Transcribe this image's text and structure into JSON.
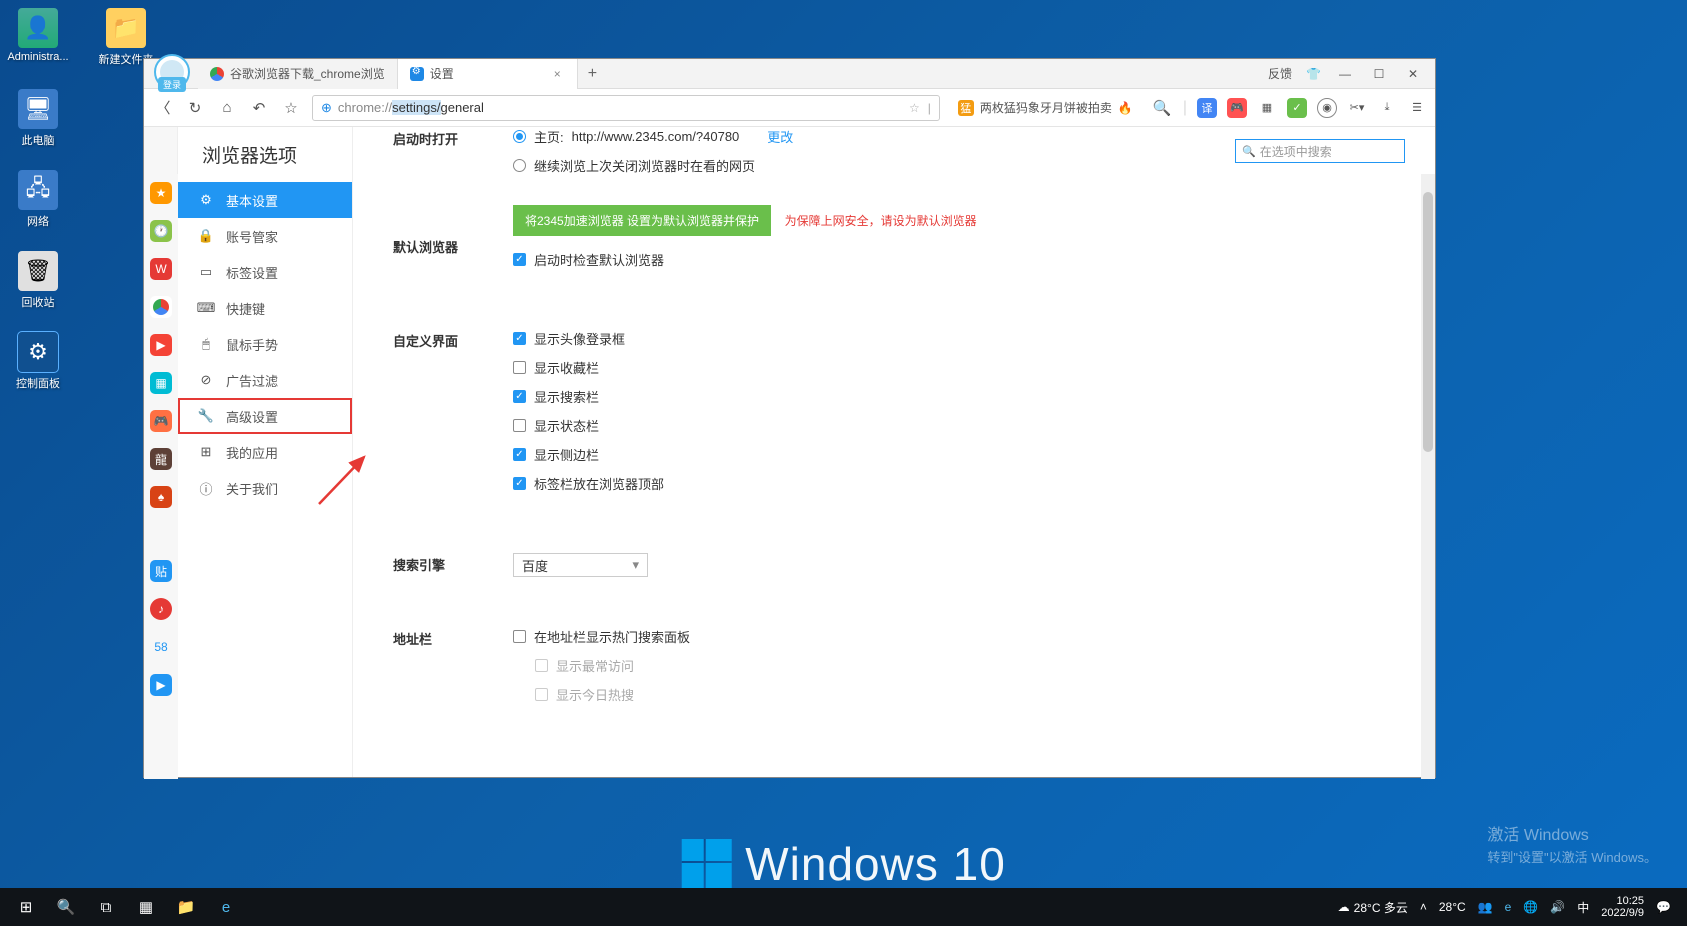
{
  "desktop": {
    "icons": [
      "Administra...",
      "新建文件夹",
      "此电脑",
      "网络",
      "回收站",
      "控制面板"
    ]
  },
  "browser": {
    "login": "登录",
    "tabs": [
      {
        "title": "谷歌浏览器下载_chrome浏览",
        "active": false
      },
      {
        "title": "设置",
        "active": true
      }
    ],
    "feedback": "反馈",
    "url_scheme": "chrome://",
    "url_path_1": "settings/",
    "url_path_2": "general",
    "promo": "两枚猛犸象牙月饼被拍卖"
  },
  "settings": {
    "title": "浏览器选项",
    "search_placeholder": "在选项中搜索",
    "nav": [
      "基本设置",
      "账号管家",
      "标签设置",
      "快捷键",
      "鼠标手势",
      "广告过滤",
      "高级设置",
      "我的应用",
      "关于我们"
    ],
    "sections": {
      "startup": {
        "label": "启动时打开",
        "opt1_prefix": "主页: ",
        "opt1_url": "http://www.2345.com/?40780",
        "opt1_link": "更改",
        "opt2": "继续浏览上次关闭浏览器时在看的网页"
      },
      "default_browser": {
        "label": "默认浏览器",
        "btn": "将2345加速浏览器 设置为默认浏览器并保护",
        "warn": "为保障上网安全，请设为默认浏览器",
        "chk": "启动时检查默认浏览器"
      },
      "custom_ui": {
        "label": "自定义界面",
        "items": [
          "显示头像登录框",
          "显示收藏栏",
          "显示搜索栏",
          "显示状态栏",
          "显示侧边栏",
          "标签栏放在浏览器顶部"
        ],
        "checked": [
          true,
          false,
          true,
          false,
          true,
          true
        ]
      },
      "search_engine": {
        "label": "搜索引擎",
        "value": "百度"
      },
      "address_bar": {
        "label": "地址栏",
        "chk": "在地址栏显示热门搜索面板",
        "sub1": "显示最常访问",
        "sub2": "显示今日热搜"
      }
    }
  },
  "watermark": {
    "l1": "激活 Windows",
    "l2": "转到\"设置\"以激活 Windows。"
  },
  "win_brand": "Windows 10",
  "taskbar": {
    "weather": "28°C 多云",
    "weather2": "28°C",
    "ime": "中",
    "time": "10:25",
    "date": "2022/9/9"
  }
}
